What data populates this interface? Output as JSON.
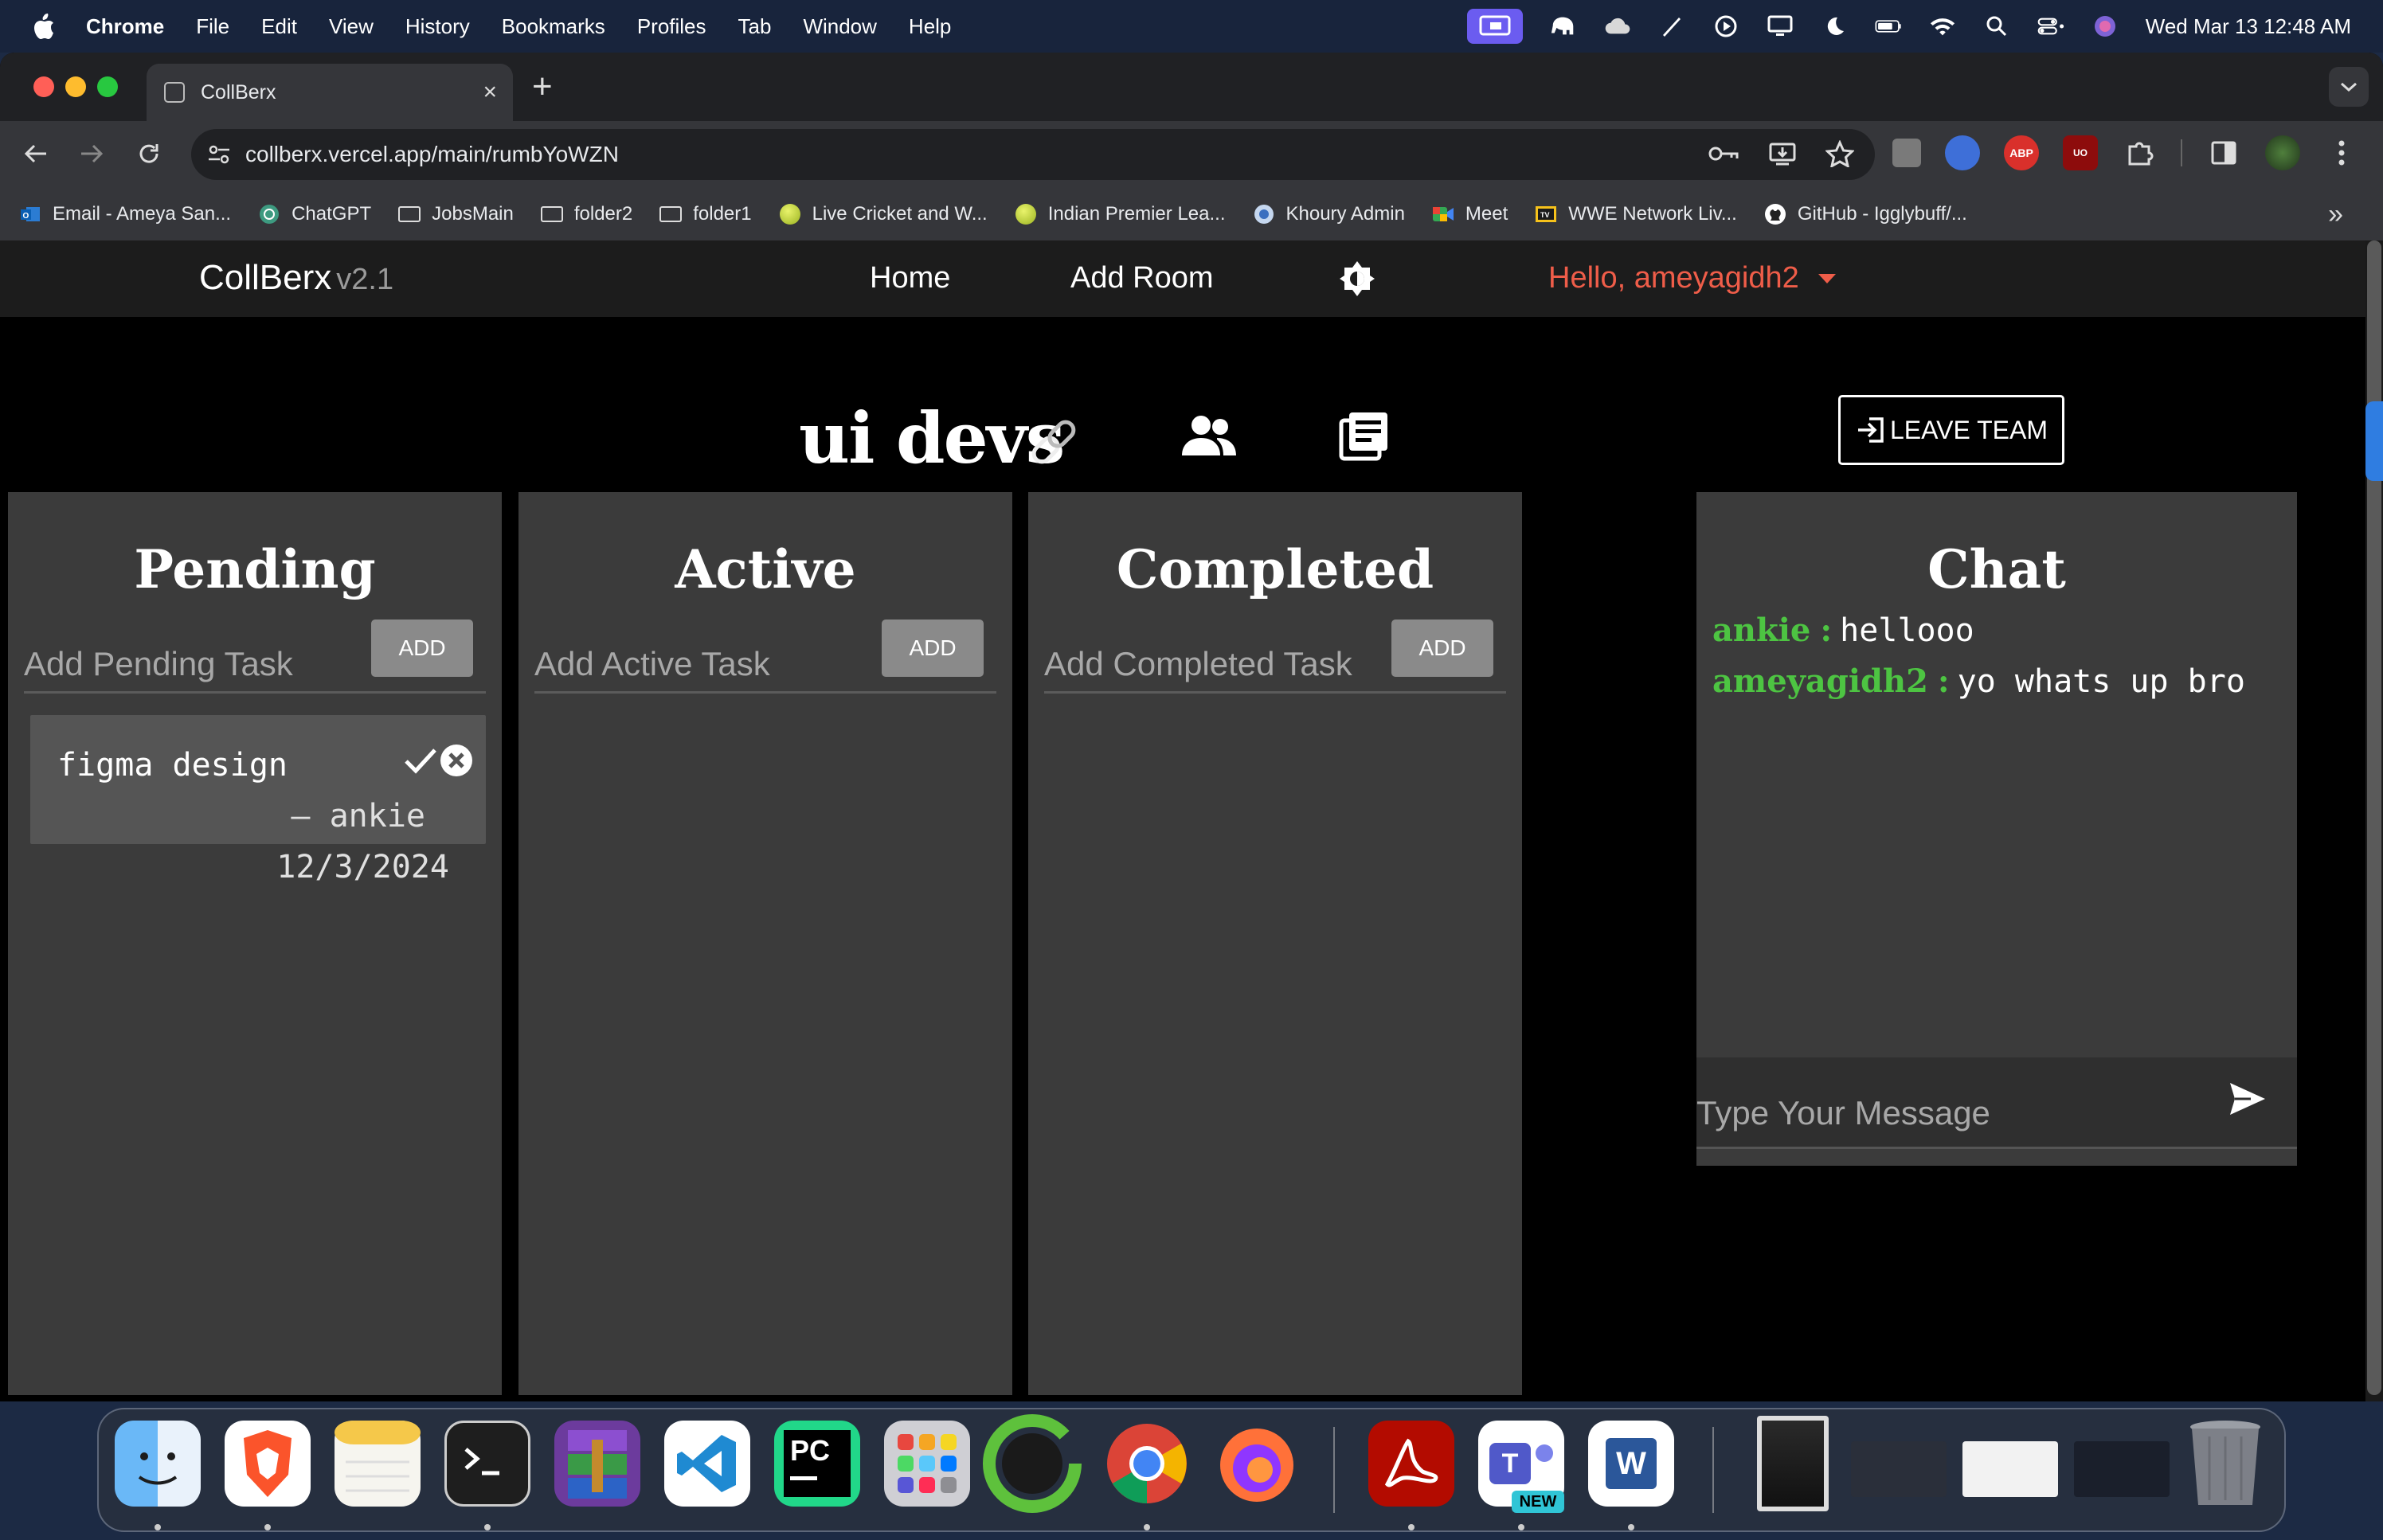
{
  "menubar": {
    "app_name": "Chrome",
    "menus": [
      "File",
      "Edit",
      "View",
      "History",
      "Bookmarks",
      "Profiles",
      "Tab",
      "Window",
      "Help"
    ],
    "clock": "Wed Mar 13  12:48 AM"
  },
  "browser": {
    "tab_title": "CollBerx",
    "new_tab_symbol": "+",
    "tab_close_symbol": "×",
    "url": "collberx.vercel.app/main/rumbYoWZN",
    "bookmarks": [
      {
        "label": "Email - Ameya San...",
        "icon": "outlook-icon"
      },
      {
        "label": "ChatGPT",
        "icon": "chatgpt-icon"
      },
      {
        "label": "JobsMain",
        "icon": "folder-icon"
      },
      {
        "label": "folder2",
        "icon": "folder-icon"
      },
      {
        "label": "folder1",
        "icon": "folder-icon"
      },
      {
        "label": "Live Cricket and W...",
        "icon": "ball-icon"
      },
      {
        "label": "Indian Premier Lea...",
        "icon": "ball-icon"
      },
      {
        "label": "Khoury Admin",
        "icon": "khoury-icon"
      },
      {
        "label": "Meet",
        "icon": "meet-icon"
      },
      {
        "label": "WWE Network Liv...",
        "icon": "tv-icon"
      },
      {
        "label": "GitHub - Igglybuff/...",
        "icon": "github-icon"
      }
    ],
    "bookmarks_more": "»"
  },
  "app": {
    "brand": "CollBerx",
    "version": "v2.1",
    "nav": {
      "home": "Home",
      "add_room": "Add Room"
    },
    "greeting": "Hello, ameyagidh2",
    "team_name": "ui devs",
    "leave_team_label": "LEAVE TEAM",
    "columns": [
      {
        "title": "Pending",
        "placeholder": "Add Pending Task",
        "add_label": "ADD"
      },
      {
        "title": "Active",
        "placeholder": "Add Active Task",
        "add_label": "ADD"
      },
      {
        "title": "Completed",
        "placeholder": "Add Completed Task",
        "add_label": "ADD"
      }
    ],
    "pending_task": {
      "title": "figma design",
      "author": "– ankie",
      "date": "12/3/2024"
    },
    "chat": {
      "title": "Chat",
      "messages": [
        {
          "sender": "ankie",
          "sep": ":",
          "text": "hellooo"
        },
        {
          "sender": "ameyagidh2",
          "sep": ":",
          "text": "yo whats up bro"
        }
      ],
      "input_placeholder": "Type Your Message"
    },
    "colors": {
      "accent_red": "#ef5d49",
      "chat_sender_green": "#4dc442",
      "panel": "#3b3b3b"
    }
  },
  "dock": {
    "apps": [
      "Finder",
      "Brave",
      "Notes",
      "Terminal",
      "RAR Extractor",
      "Visual Studio Code",
      "PyCharm",
      "Launchpad",
      "Upwork Time Tracker",
      "Google Chrome",
      "Firefox",
      "Adobe Acrobat",
      "Microsoft Teams",
      "Microsoft Word"
    ],
    "new_badge": "NEW",
    "apps_text": {
      "pycharm": "PC",
      "word": "W",
      "teams": "T"
    }
  }
}
